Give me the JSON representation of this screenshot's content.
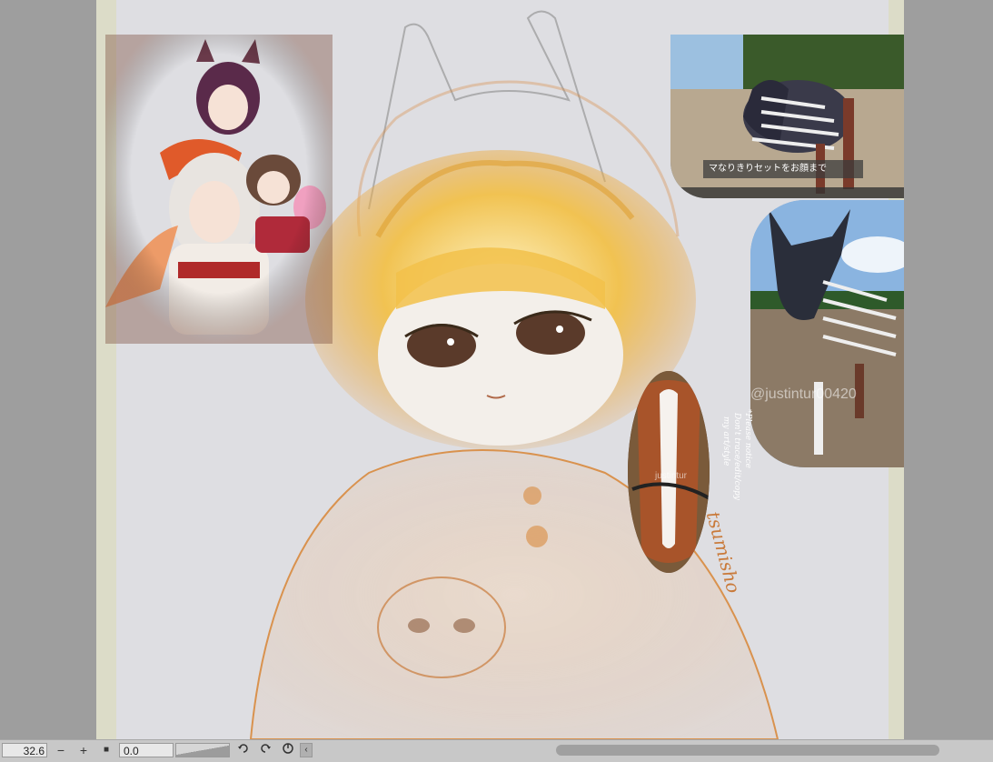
{
  "canvas": {
    "reference_caption": "マなりきりセットをお顔まで",
    "watermark_large": "@justintur00420",
    "watermark_small": "justintur",
    "note_lines": [
      "*Please notice",
      "Don't trace/edit/copy",
      "my art/style"
    ],
    "signature": "tsumisho"
  },
  "statusbar": {
    "zoom_value": "32.6",
    "zoom_out_label": "−",
    "zoom_in_label": "+",
    "fit_label": "■",
    "angle_value": "0.0",
    "scroll_left_label": "‹",
    "icons": [
      "rotate-left-icon",
      "rotate-right-icon",
      "reset-rotation-icon"
    ]
  },
  "colors": {
    "workspace": "#9e9e9e",
    "paper": "#dedee2",
    "sketch_orange": "#d98a3e",
    "hair_yellow": "#f2c14a",
    "statusbar": "#c8c8c8"
  }
}
